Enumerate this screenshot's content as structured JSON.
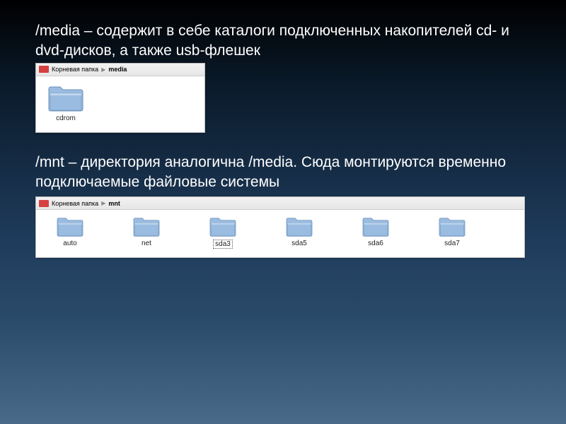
{
  "section1": {
    "desc": "/media – содержит в себе каталоги подключенных накопителей cd- и dvd-дисков, а также usb-флешек",
    "breadcrumb": {
      "root": "Корневая папка",
      "current": "media"
    },
    "items": [
      {
        "label": "cdrom",
        "selected": false
      }
    ]
  },
  "section2": {
    "desc": "/mnt – директория аналогична /media. Сюда монтируются временно подключаемые файловые системы",
    "breadcrumb": {
      "root": "Корневая папка",
      "current": "mnt"
    },
    "items": [
      {
        "label": "auto",
        "selected": false
      },
      {
        "label": "net",
        "selected": false
      },
      {
        "label": "sda3",
        "selected": true
      },
      {
        "label": "sda5",
        "selected": false
      },
      {
        "label": "sda6",
        "selected": false
      },
      {
        "label": "sda7",
        "selected": false
      }
    ]
  }
}
